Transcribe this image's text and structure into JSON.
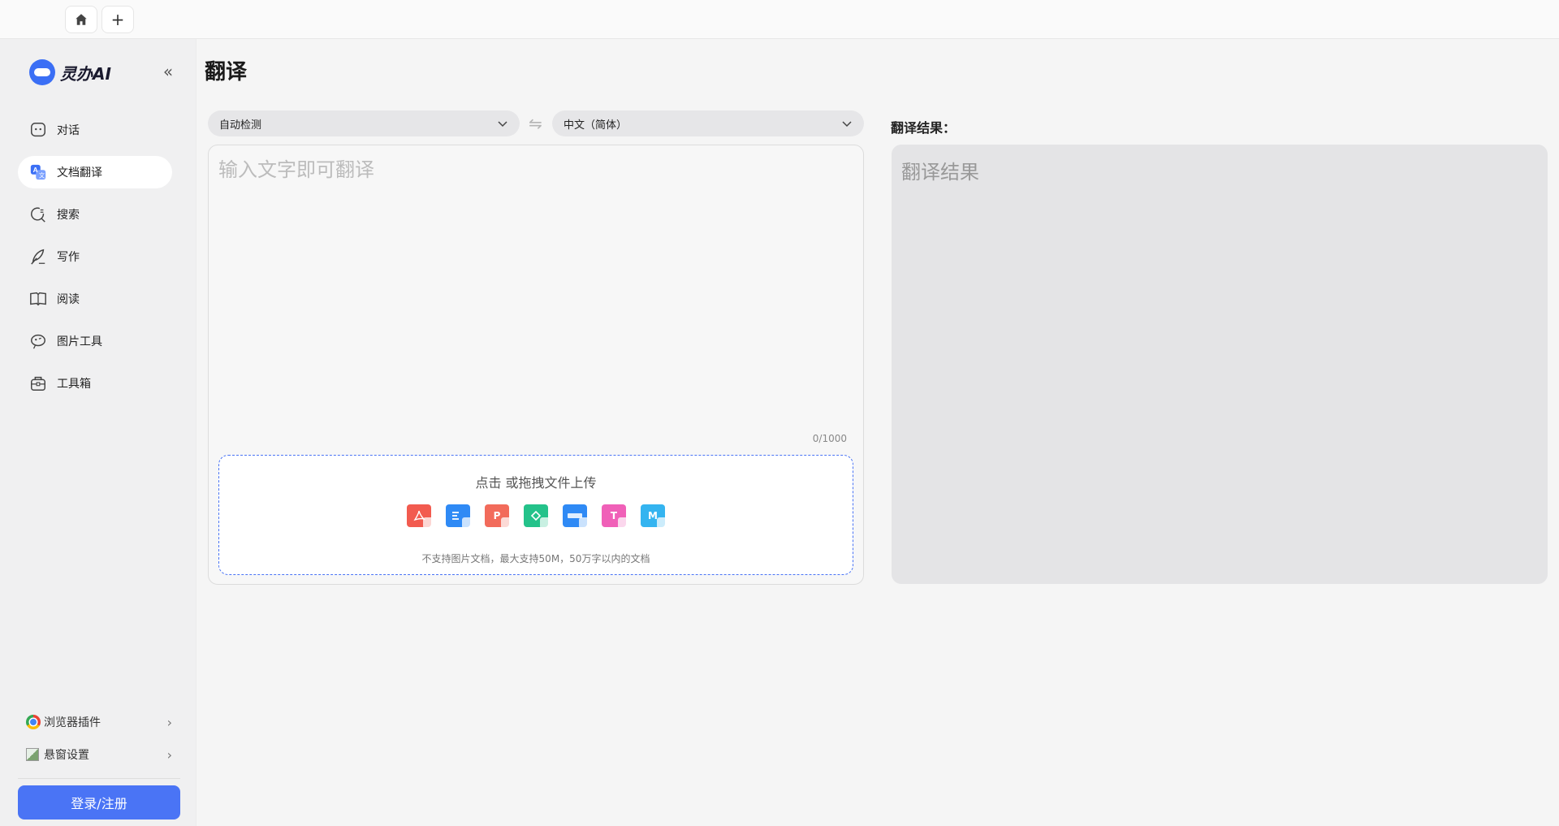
{
  "tabs": {
    "add_label": "+"
  },
  "brand": {
    "name": "灵办AI"
  },
  "sidebar": {
    "collapse_label": "«",
    "items": [
      {
        "label": "对话",
        "icon": "chat-icon",
        "active": false
      },
      {
        "label": "文档翻译",
        "icon": "translate-icon",
        "active": true
      },
      {
        "label": "搜索",
        "icon": "search-icon",
        "active": false
      },
      {
        "label": "写作",
        "icon": "pen-icon",
        "active": false
      },
      {
        "label": "阅读",
        "icon": "book-icon",
        "active": false
      },
      {
        "label": "图片工具",
        "icon": "image-tool-icon",
        "active": false
      },
      {
        "label": "工具箱",
        "icon": "toolbox-icon",
        "active": false
      }
    ],
    "browser_plugin": "浏览器插件",
    "float_settings": "悬窗设置",
    "login_label": "登录/注册"
  },
  "main": {
    "title": "翻译",
    "source_lang": "自动检测",
    "target_lang": "中文（简体）",
    "input_placeholder": "输入文字即可翻译",
    "char_count": "0/1000",
    "upload_text": "点击 或拖拽文件上传",
    "upload_note": "不支持图片文档，最大支持50M，50万字以内的文档",
    "file_types": [
      {
        "name": "pdf-file-icon",
        "glyph": "",
        "color": "#f25b4f"
      },
      {
        "name": "word-file-icon",
        "glyph": "",
        "color": "#2f8af5"
      },
      {
        "name": "ppt-file-icon",
        "glyph": "P",
        "color": "#f26b5b"
      },
      {
        "name": "excel-file-icon",
        "glyph": "",
        "color": "#24c28a"
      },
      {
        "name": "mobi-file-icon",
        "glyph": "",
        "color": "#2f8af5"
      },
      {
        "name": "txt-file-icon",
        "glyph": "T",
        "color": "#f060b8"
      },
      {
        "name": "markdown-file-icon",
        "glyph": "M",
        "color": "#34b4f0"
      }
    ],
    "result_label": "翻译结果：",
    "result_placeholder": "翻译结果"
  }
}
